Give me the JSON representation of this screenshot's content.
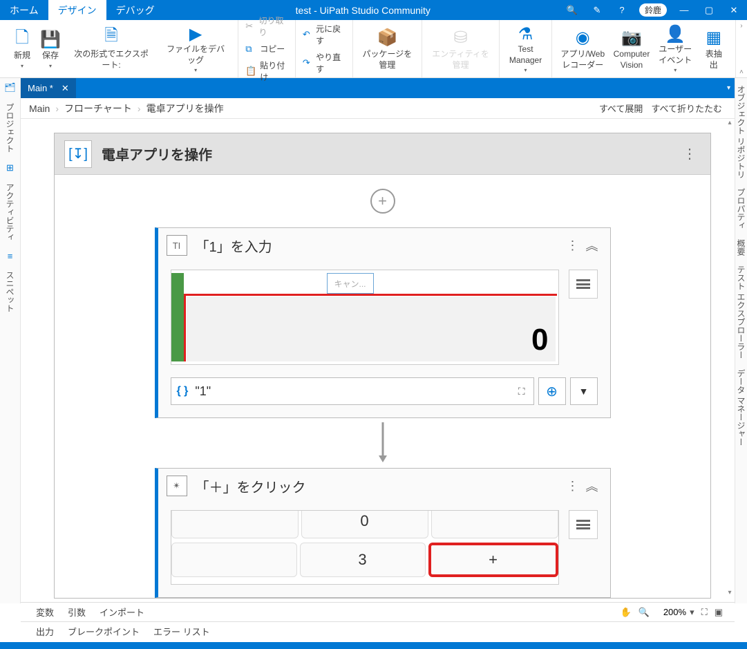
{
  "titlebar": {
    "tabs": [
      "ホーム",
      "デザイン",
      "デバッグ"
    ],
    "active_tab": 1,
    "title": "test - UiPath Studio Community",
    "user": "鈴鹿"
  },
  "ribbon": {
    "new": "新規",
    "save": "保存",
    "export": "次の形式でエクスポート:",
    "debug_file": "ファイルをデバッグ",
    "cut": "切り取り",
    "copy": "コピー",
    "paste": "貼り付け",
    "undo": "元に戻す",
    "redo": "やり直す",
    "manage_packages": "パッケージを\n管理",
    "manage_entities": "エンティティを\n管理",
    "test_manager": "Test\nManager",
    "app_recorder": "アプリ/Web\nレコーダー",
    "computer_vision": "Computer\nVision",
    "user_events": "ユーザー\nイベント",
    "table_extract": "表抽出"
  },
  "doc_tab": {
    "name": "Main *"
  },
  "breadcrumb": [
    "Main",
    "フローチャート",
    "電卓アプリを操作"
  ],
  "expand_all": "すべて展開",
  "collapse_all": "すべて折りたたむ",
  "sequence": {
    "title": "電卓アプリを操作"
  },
  "activities": [
    {
      "title": "「1」を入力",
      "icon_label": "TI",
      "target": {
        "placeholder": "キャン...",
        "display": "0"
      },
      "expression": "\"1\""
    },
    {
      "title": "「＋」をクリック",
      "target": {
        "row1": [
          "",
          "0",
          ""
        ],
        "row2": [
          "",
          "3",
          "+"
        ]
      }
    }
  ],
  "left_rail": [
    "プロジェクト",
    "アクティビティ",
    "スニペット"
  ],
  "right_rail": [
    "オブジェクト リポジトリ",
    "プロパティ",
    "概要",
    "テスト エクスプローラー",
    "データ マネージャー"
  ],
  "bottom1": {
    "vars": "変数",
    "args": "引数",
    "imports": "インポート",
    "zoom": "200%"
  },
  "bottom2": {
    "output": "出力",
    "breakpoints": "ブレークポイント",
    "errors": "エラー リスト"
  }
}
